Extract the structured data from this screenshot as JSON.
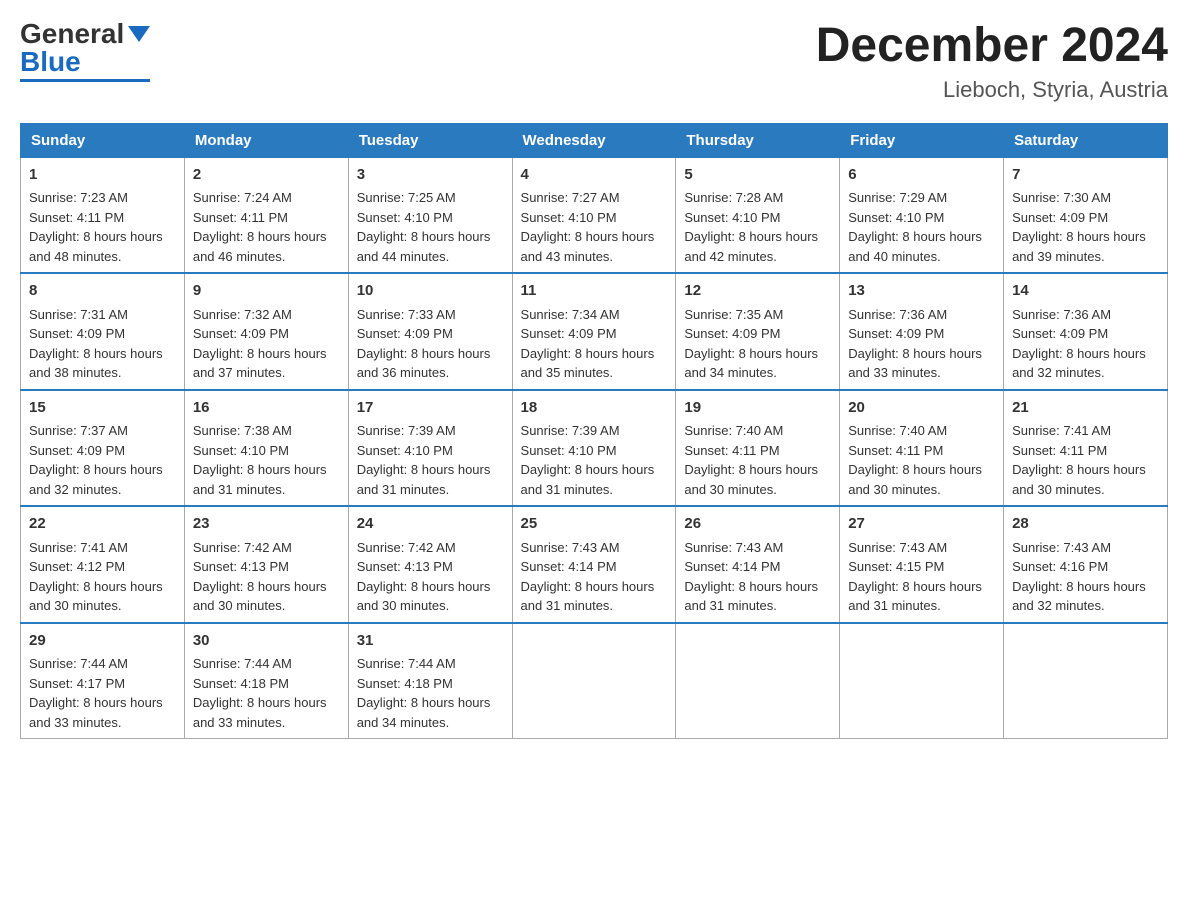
{
  "header": {
    "logo_general": "General",
    "logo_blue": "Blue",
    "month_year": "December 2024",
    "location": "Lieboch, Styria, Austria"
  },
  "weekdays": [
    "Sunday",
    "Monday",
    "Tuesday",
    "Wednesday",
    "Thursday",
    "Friday",
    "Saturday"
  ],
  "weeks": [
    [
      {
        "day": "1",
        "sunrise": "7:23 AM",
        "sunset": "4:11 PM",
        "daylight": "8 hours and 48 minutes."
      },
      {
        "day": "2",
        "sunrise": "7:24 AM",
        "sunset": "4:11 PM",
        "daylight": "8 hours and 46 minutes."
      },
      {
        "day": "3",
        "sunrise": "7:25 AM",
        "sunset": "4:10 PM",
        "daylight": "8 hours and 44 minutes."
      },
      {
        "day": "4",
        "sunrise": "7:27 AM",
        "sunset": "4:10 PM",
        "daylight": "8 hours and 43 minutes."
      },
      {
        "day": "5",
        "sunrise": "7:28 AM",
        "sunset": "4:10 PM",
        "daylight": "8 hours and 42 minutes."
      },
      {
        "day": "6",
        "sunrise": "7:29 AM",
        "sunset": "4:10 PM",
        "daylight": "8 hours and 40 minutes."
      },
      {
        "day": "7",
        "sunrise": "7:30 AM",
        "sunset": "4:09 PM",
        "daylight": "8 hours and 39 minutes."
      }
    ],
    [
      {
        "day": "8",
        "sunrise": "7:31 AM",
        "sunset": "4:09 PM",
        "daylight": "8 hours and 38 minutes."
      },
      {
        "day": "9",
        "sunrise": "7:32 AM",
        "sunset": "4:09 PM",
        "daylight": "8 hours and 37 minutes."
      },
      {
        "day": "10",
        "sunrise": "7:33 AM",
        "sunset": "4:09 PM",
        "daylight": "8 hours and 36 minutes."
      },
      {
        "day": "11",
        "sunrise": "7:34 AM",
        "sunset": "4:09 PM",
        "daylight": "8 hours and 35 minutes."
      },
      {
        "day": "12",
        "sunrise": "7:35 AM",
        "sunset": "4:09 PM",
        "daylight": "8 hours and 34 minutes."
      },
      {
        "day": "13",
        "sunrise": "7:36 AM",
        "sunset": "4:09 PM",
        "daylight": "8 hours and 33 minutes."
      },
      {
        "day": "14",
        "sunrise": "7:36 AM",
        "sunset": "4:09 PM",
        "daylight": "8 hours and 32 minutes."
      }
    ],
    [
      {
        "day": "15",
        "sunrise": "7:37 AM",
        "sunset": "4:09 PM",
        "daylight": "8 hours and 32 minutes."
      },
      {
        "day": "16",
        "sunrise": "7:38 AM",
        "sunset": "4:10 PM",
        "daylight": "8 hours and 31 minutes."
      },
      {
        "day": "17",
        "sunrise": "7:39 AM",
        "sunset": "4:10 PM",
        "daylight": "8 hours and 31 minutes."
      },
      {
        "day": "18",
        "sunrise": "7:39 AM",
        "sunset": "4:10 PM",
        "daylight": "8 hours and 31 minutes."
      },
      {
        "day": "19",
        "sunrise": "7:40 AM",
        "sunset": "4:11 PM",
        "daylight": "8 hours and 30 minutes."
      },
      {
        "day": "20",
        "sunrise": "7:40 AM",
        "sunset": "4:11 PM",
        "daylight": "8 hours and 30 minutes."
      },
      {
        "day": "21",
        "sunrise": "7:41 AM",
        "sunset": "4:11 PM",
        "daylight": "8 hours and 30 minutes."
      }
    ],
    [
      {
        "day": "22",
        "sunrise": "7:41 AM",
        "sunset": "4:12 PM",
        "daylight": "8 hours and 30 minutes."
      },
      {
        "day": "23",
        "sunrise": "7:42 AM",
        "sunset": "4:13 PM",
        "daylight": "8 hours and 30 minutes."
      },
      {
        "day": "24",
        "sunrise": "7:42 AM",
        "sunset": "4:13 PM",
        "daylight": "8 hours and 30 minutes."
      },
      {
        "day": "25",
        "sunrise": "7:43 AM",
        "sunset": "4:14 PM",
        "daylight": "8 hours and 31 minutes."
      },
      {
        "day": "26",
        "sunrise": "7:43 AM",
        "sunset": "4:14 PM",
        "daylight": "8 hours and 31 minutes."
      },
      {
        "day": "27",
        "sunrise": "7:43 AM",
        "sunset": "4:15 PM",
        "daylight": "8 hours and 31 minutes."
      },
      {
        "day": "28",
        "sunrise": "7:43 AM",
        "sunset": "4:16 PM",
        "daylight": "8 hours and 32 minutes."
      }
    ],
    [
      {
        "day": "29",
        "sunrise": "7:44 AM",
        "sunset": "4:17 PM",
        "daylight": "8 hours and 33 minutes."
      },
      {
        "day": "30",
        "sunrise": "7:44 AM",
        "sunset": "4:18 PM",
        "daylight": "8 hours and 33 minutes."
      },
      {
        "day": "31",
        "sunrise": "7:44 AM",
        "sunset": "4:18 PM",
        "daylight": "8 hours and 34 minutes."
      },
      null,
      null,
      null,
      null
    ]
  ]
}
